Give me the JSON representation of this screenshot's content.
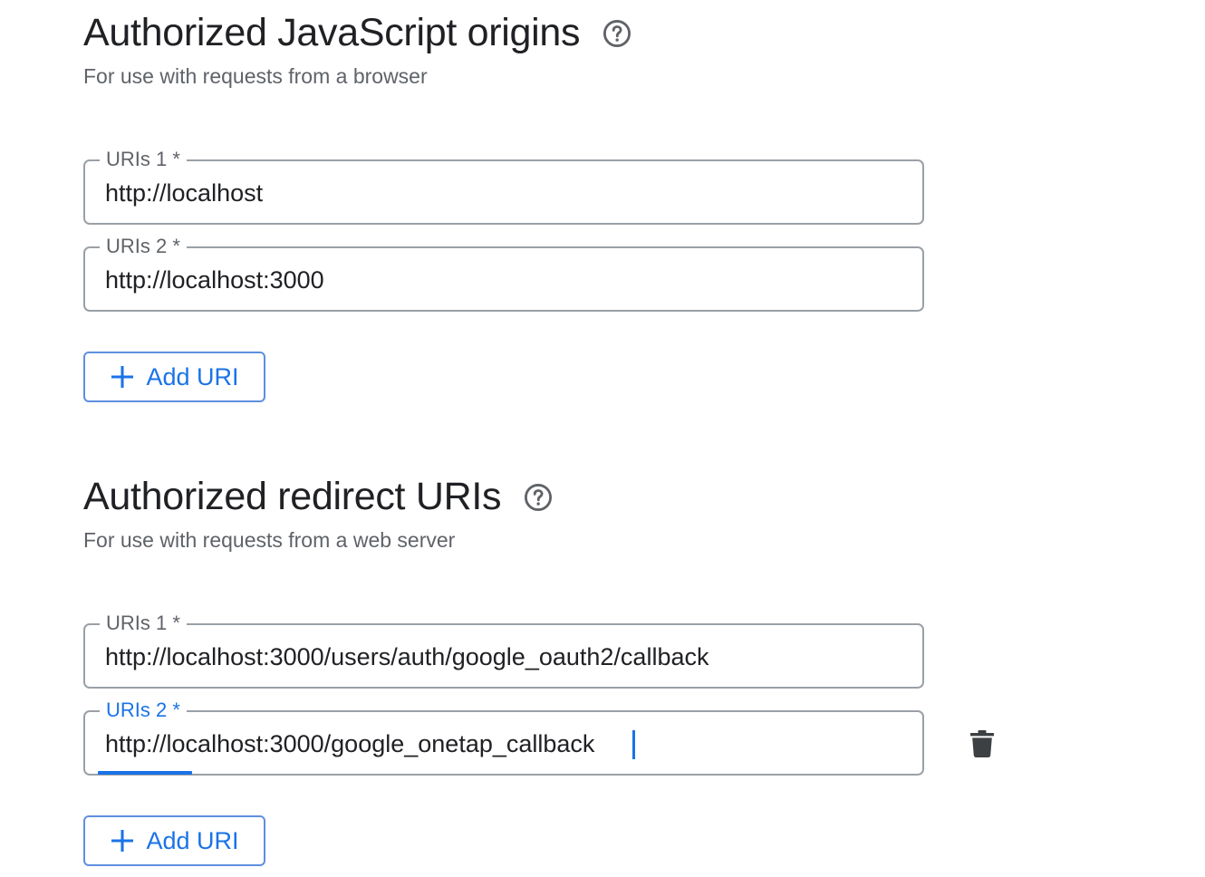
{
  "javascript_origins": {
    "title": "Authorized JavaScript origins",
    "subtitle": "For use with requests from a browser",
    "help_icon": "help-circle-icon",
    "uris": [
      {
        "label": "URIs 1 *",
        "value": "http://localhost"
      },
      {
        "label": "URIs 2 *",
        "value": "http://localhost:3000"
      }
    ],
    "add_button_label": "Add URI",
    "add_icon": "plus-icon"
  },
  "redirect_uris": {
    "title": "Authorized redirect URIs",
    "subtitle": "For use with requests from a web server",
    "help_icon": "help-circle-icon",
    "uris": [
      {
        "label": "URIs 1 *",
        "value": "http://localhost:3000/users/auth/google_oauth2/callback"
      },
      {
        "label": "URIs 2 *",
        "value": "http://localhost:3000/google_onetap_callback",
        "focused": true
      }
    ],
    "delete_icon": "trash-icon",
    "add_button_label": "Add URI",
    "add_icon": "plus-icon"
  },
  "colors": {
    "primary": "#1a73e8",
    "text": "#202124",
    "secondary_text": "#5f6368",
    "border": "#9aa0a6"
  }
}
